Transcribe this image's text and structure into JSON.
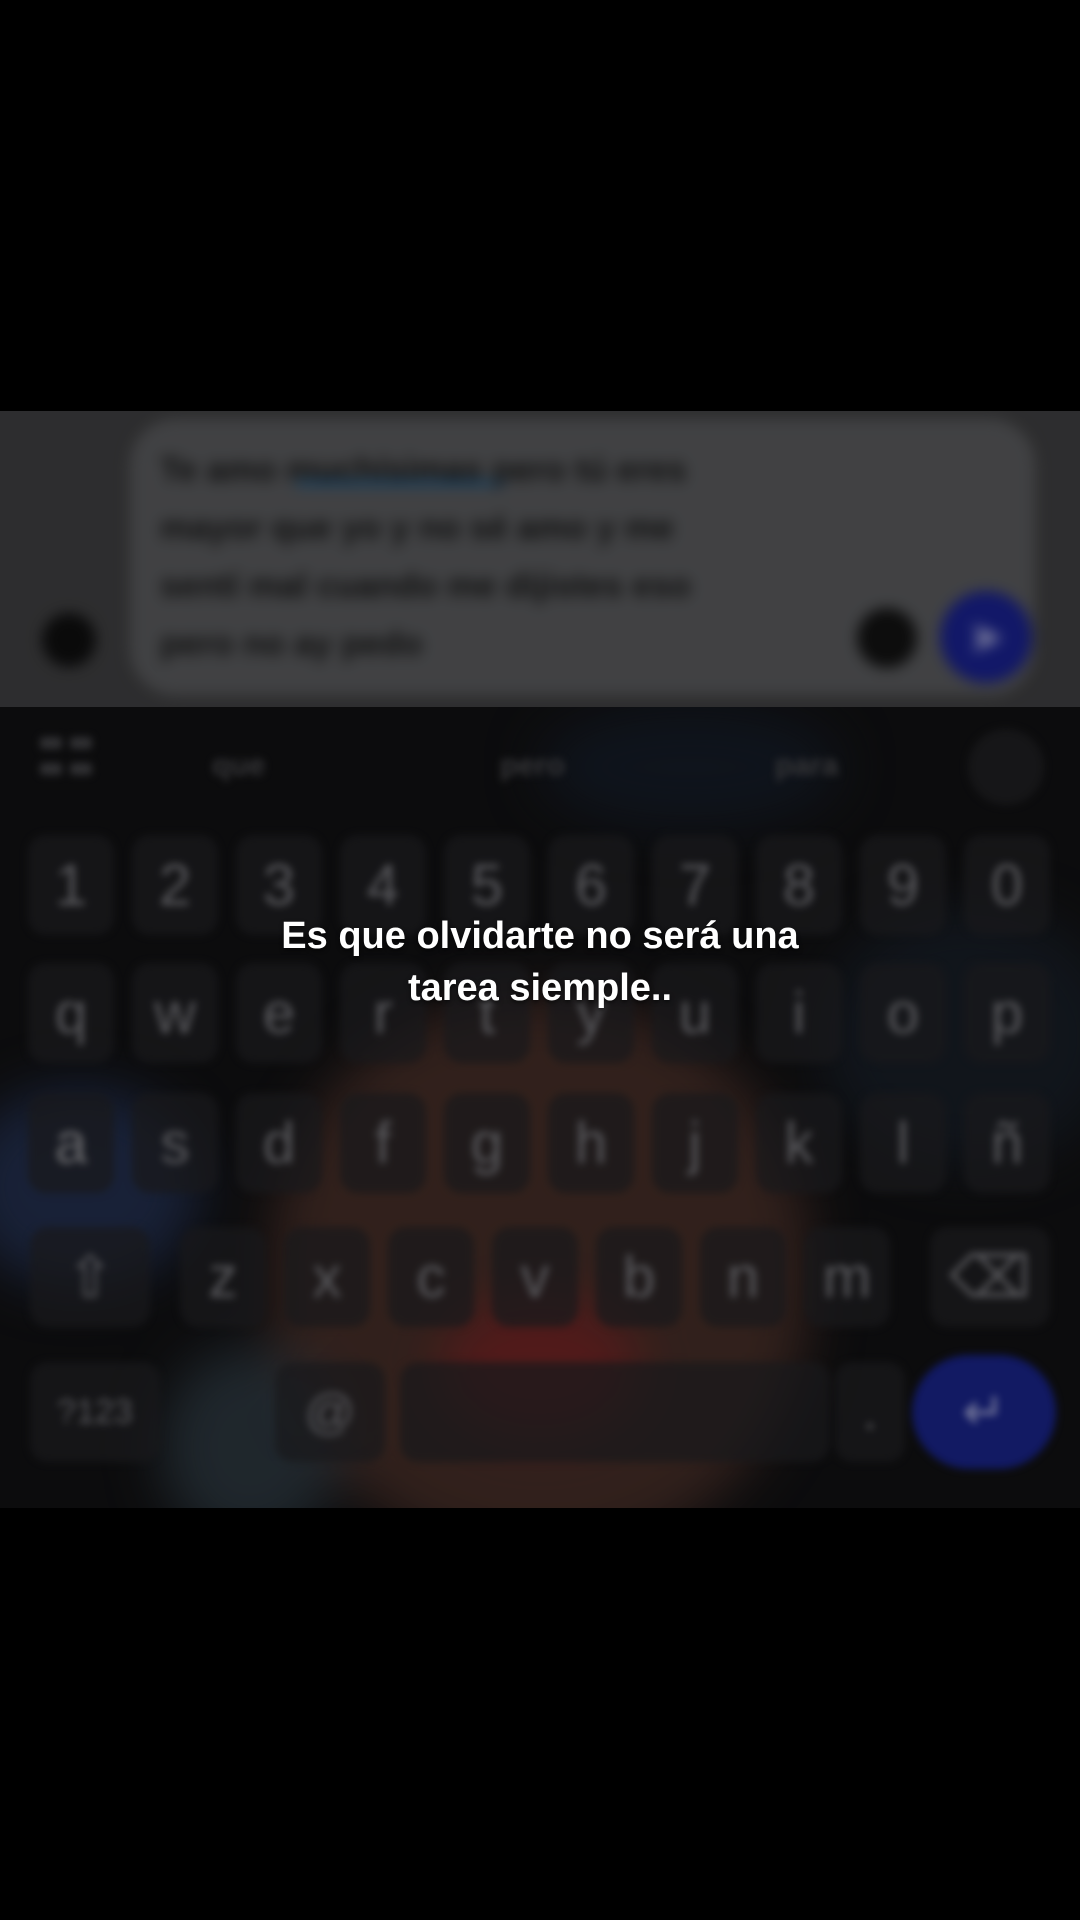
{
  "message": {
    "lines": [
      "Te amo muchísimas pero tú eres",
      "mayor que yo y no sé amo y me",
      "sentí mal cuando me dijistes eso",
      "pero no ay pedo"
    ]
  },
  "compose": {
    "emoji_icon": "emoji-icon",
    "sticker_icon": "sticker-icon",
    "send_icon": "send-icon",
    "send_glyph": "➤",
    "accent_color": "#1d27a8"
  },
  "keyboard": {
    "suggestions": [
      "que",
      "pero",
      "para"
    ],
    "number_row": [
      "1",
      "2",
      "3",
      "4",
      "5",
      "6",
      "7",
      "8",
      "9",
      "0"
    ],
    "row1": [
      "q",
      "w",
      "e",
      "r",
      "t",
      "y",
      "u",
      "i",
      "o",
      "p"
    ],
    "row2": [
      "a",
      "s",
      "d",
      "f",
      "g",
      "h",
      "j",
      "k",
      "l",
      "ñ"
    ],
    "row3": [
      "z",
      "x",
      "c",
      "v",
      "b",
      "n",
      "m"
    ],
    "shift_glyph": "⇧",
    "delete_glyph": "⌫",
    "numbers_label": "?123",
    "at_label": "@",
    "period_label": ".",
    "enter_glyph": "↵"
  },
  "caption": {
    "line1": "Es que olvidarte no será una",
    "line2": "tarea siemple.."
  }
}
